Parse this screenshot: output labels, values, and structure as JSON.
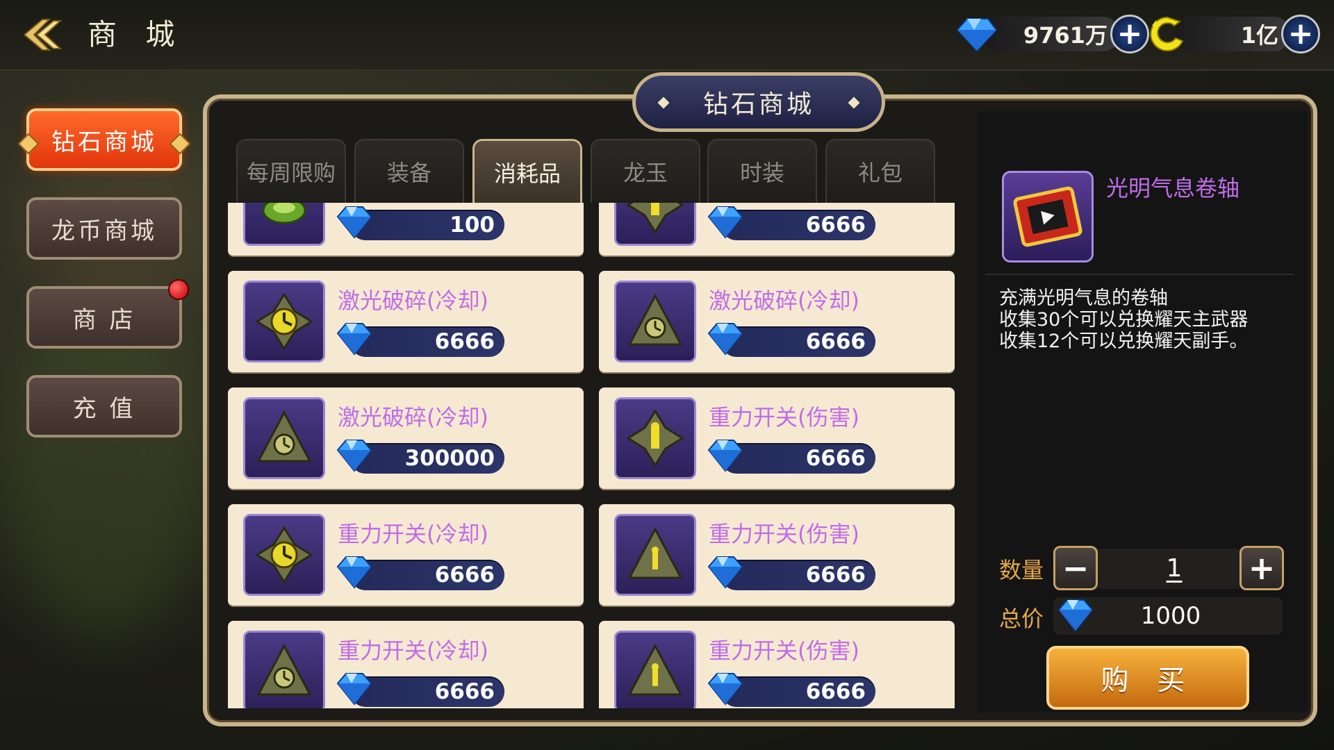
{
  "header": {
    "title": "商 城",
    "diamonds": "9761万",
    "coins": "1亿"
  },
  "side_menu": {
    "items": [
      "钻石商城",
      "龙币商城",
      "商 店",
      "充 值"
    ],
    "active": "钻石商城"
  },
  "store": {
    "title": "钻石商城",
    "tabs": [
      "每周限购",
      "装备",
      "消耗品",
      "龙玉",
      "时装",
      "礼包"
    ],
    "active_tab": "消耗品"
  },
  "items": [
    {
      "name": "",
      "price": "100",
      "icon": "green-orb-icon"
    },
    {
      "name": "",
      "price": "6666",
      "icon": "gravity-ornament-icon"
    },
    {
      "name": "激光破碎(冷却)",
      "price": "6666",
      "icon": "clock-ornament-icon"
    },
    {
      "name": "激光破碎(冷却)",
      "price": "6666",
      "icon": "clock-triangle-icon"
    },
    {
      "name": "激光破碎(冷却)",
      "price": "300000",
      "icon": "clock-triangle-icon"
    },
    {
      "name": "重力开关(伤害)",
      "price": "6666",
      "icon": "gravity-ornament-icon"
    },
    {
      "name": "重力开关(冷却)",
      "price": "6666",
      "icon": "clock-ornament-icon"
    },
    {
      "name": "重力开关(伤害)",
      "price": "6666",
      "icon": "gravity-triangle-icon"
    },
    {
      "name": "重力开关(冷却)",
      "price": "6666",
      "icon": "clock-triangle-icon"
    },
    {
      "name": "重力开关(伤害)",
      "price": "6666",
      "icon": "gravity-triangle-icon"
    }
  ],
  "detail": {
    "name": "光明气息卷轴",
    "icon": "scroll-icon",
    "description": "充满光明气息的卷轴\n收集30个可以兑换耀天主武器\n收集12个可以兑换耀天副手。",
    "quantity_label": "数量",
    "quantity": "1",
    "total_label": "总价",
    "total": "1000",
    "buy_label": "购 买"
  },
  "colors": {
    "accent_orange": "#e1360c",
    "item_name_purple": "#c06de8",
    "gold_label": "#e4a84a",
    "card_bg": "#f6e9d2"
  }
}
